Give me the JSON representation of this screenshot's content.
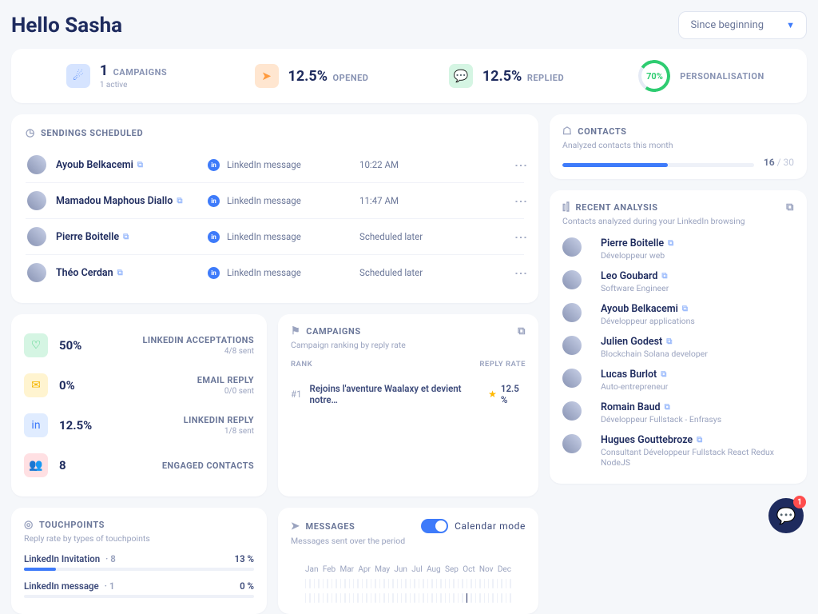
{
  "header": {
    "greeting": "Hello Sasha",
    "period": "Since beginning"
  },
  "stats": {
    "campaigns": {
      "value": "1",
      "label": "CAMPAIGNS",
      "sub": "1 active"
    },
    "opened": {
      "value": "12.5%",
      "label": "OPENED"
    },
    "replied": {
      "value": "12.5%",
      "label": "REPLIED"
    },
    "personalisation": {
      "value": "70%",
      "label": "PERSONALISATION"
    }
  },
  "sendings": {
    "title": "SENDINGS SCHEDULED",
    "type_label": "LinkedIn message",
    "rows": [
      {
        "name": "Ayoub Belkacemi",
        "time": "10:22 AM"
      },
      {
        "name": "Mamadou Maphous Diallo",
        "time": "11:47 AM"
      },
      {
        "name": "Pierre Boitelle",
        "time": "Scheduled later"
      },
      {
        "name": "Théo Cerdan",
        "time": "Scheduled later"
      }
    ]
  },
  "metrics": [
    {
      "value": "50%",
      "label": "LINKEDIN ACCEPTATIONS",
      "sub": "4/8 sent",
      "icon": "heart",
      "cls": "ic-mint"
    },
    {
      "value": "0%",
      "label": "EMAIL REPLY",
      "sub": "0/0 sent",
      "icon": "mail",
      "cls": "ic-yel"
    },
    {
      "value": "12.5%",
      "label": "LINKEDIN REPLY",
      "sub": "1/8 sent",
      "icon": "in",
      "cls": "ic-lblue"
    },
    {
      "value": "8",
      "label": "ENGAGED CONTACTS",
      "sub": "",
      "icon": "users",
      "cls": "ic-pink"
    }
  ],
  "campaigns": {
    "title": "CAMPAIGNS",
    "sub": "Campaign ranking by reply rate",
    "col_rank": "RANK",
    "col_rate": "REPLY RATE",
    "row": {
      "rank": "#1",
      "name": "Rejoins l'aventure Waalaxy et devient notre…",
      "rate": "12.5 %"
    }
  },
  "contacts": {
    "title": "CONTACTS",
    "sub": "Analyzed contacts this month",
    "count": "16",
    "max": "/ 30"
  },
  "analysis": {
    "title": "RECENT ANALYSIS",
    "sub": "Contacts analyzed during your LinkedIn browsing",
    "rows": [
      {
        "name": "Pierre Boitelle",
        "role": "Développeur web"
      },
      {
        "name": "Leo Goubard",
        "role": "Software Engineer"
      },
      {
        "name": "Ayoub Belkacemi",
        "role": "Développeur applications"
      },
      {
        "name": "Julien Godest",
        "role": "Blockchain Solana developer"
      },
      {
        "name": "Lucas Burlot",
        "role": "Auto-entrepreneur"
      },
      {
        "name": "Romain Baud",
        "role": "Développeur Fullstack - Enfrasys"
      },
      {
        "name": "Hugues Gouttebroze",
        "role": "Consultant Développeur Fullstack React Redux NodeJS"
      }
    ]
  },
  "touchpoints": {
    "title": "TOUCHPOINTS",
    "sub": "Reply rate by types of touchpoints",
    "rows": [
      {
        "name": "LinkedIn Invitation",
        "count": "8",
        "rate": "13 %",
        "width": 14
      },
      {
        "name": "LinkedIn message",
        "count": "1",
        "rate": "0 %",
        "width": 0
      }
    ]
  },
  "messages": {
    "title": "MESSAGES",
    "sub": "Messages sent over the period",
    "toggle_label": "Calendar mode",
    "months": [
      "Jan",
      "Feb",
      "Mar",
      "Apr",
      "May",
      "Jun",
      "Jul",
      "Aug",
      "Sep",
      "Oct",
      "Nov",
      "Dec"
    ]
  },
  "chat_badge": "1"
}
